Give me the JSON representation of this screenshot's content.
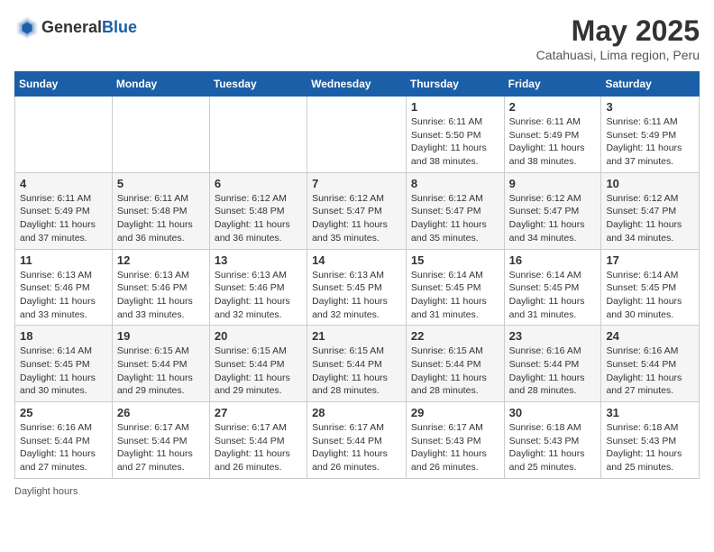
{
  "header": {
    "logo_general": "General",
    "logo_blue": "Blue",
    "month": "May 2025",
    "location": "Catahuasi, Lima region, Peru"
  },
  "days_of_week": [
    "Sunday",
    "Monday",
    "Tuesday",
    "Wednesday",
    "Thursday",
    "Friday",
    "Saturday"
  ],
  "weeks": [
    [
      {
        "day": "",
        "info": ""
      },
      {
        "day": "",
        "info": ""
      },
      {
        "day": "",
        "info": ""
      },
      {
        "day": "",
        "info": ""
      },
      {
        "day": "1",
        "info": "Sunrise: 6:11 AM\nSunset: 5:50 PM\nDaylight: 11 hours and 38 minutes."
      },
      {
        "day": "2",
        "info": "Sunrise: 6:11 AM\nSunset: 5:49 PM\nDaylight: 11 hours and 38 minutes."
      },
      {
        "day": "3",
        "info": "Sunrise: 6:11 AM\nSunset: 5:49 PM\nDaylight: 11 hours and 37 minutes."
      }
    ],
    [
      {
        "day": "4",
        "info": "Sunrise: 6:11 AM\nSunset: 5:49 PM\nDaylight: 11 hours and 37 minutes."
      },
      {
        "day": "5",
        "info": "Sunrise: 6:11 AM\nSunset: 5:48 PM\nDaylight: 11 hours and 36 minutes."
      },
      {
        "day": "6",
        "info": "Sunrise: 6:12 AM\nSunset: 5:48 PM\nDaylight: 11 hours and 36 minutes."
      },
      {
        "day": "7",
        "info": "Sunrise: 6:12 AM\nSunset: 5:47 PM\nDaylight: 11 hours and 35 minutes."
      },
      {
        "day": "8",
        "info": "Sunrise: 6:12 AM\nSunset: 5:47 PM\nDaylight: 11 hours and 35 minutes."
      },
      {
        "day": "9",
        "info": "Sunrise: 6:12 AM\nSunset: 5:47 PM\nDaylight: 11 hours and 34 minutes."
      },
      {
        "day": "10",
        "info": "Sunrise: 6:12 AM\nSunset: 5:47 PM\nDaylight: 11 hours and 34 minutes."
      }
    ],
    [
      {
        "day": "11",
        "info": "Sunrise: 6:13 AM\nSunset: 5:46 PM\nDaylight: 11 hours and 33 minutes."
      },
      {
        "day": "12",
        "info": "Sunrise: 6:13 AM\nSunset: 5:46 PM\nDaylight: 11 hours and 33 minutes."
      },
      {
        "day": "13",
        "info": "Sunrise: 6:13 AM\nSunset: 5:46 PM\nDaylight: 11 hours and 32 minutes."
      },
      {
        "day": "14",
        "info": "Sunrise: 6:13 AM\nSunset: 5:45 PM\nDaylight: 11 hours and 32 minutes."
      },
      {
        "day": "15",
        "info": "Sunrise: 6:14 AM\nSunset: 5:45 PM\nDaylight: 11 hours and 31 minutes."
      },
      {
        "day": "16",
        "info": "Sunrise: 6:14 AM\nSunset: 5:45 PM\nDaylight: 11 hours and 31 minutes."
      },
      {
        "day": "17",
        "info": "Sunrise: 6:14 AM\nSunset: 5:45 PM\nDaylight: 11 hours and 30 minutes."
      }
    ],
    [
      {
        "day": "18",
        "info": "Sunrise: 6:14 AM\nSunset: 5:45 PM\nDaylight: 11 hours and 30 minutes."
      },
      {
        "day": "19",
        "info": "Sunrise: 6:15 AM\nSunset: 5:44 PM\nDaylight: 11 hours and 29 minutes."
      },
      {
        "day": "20",
        "info": "Sunrise: 6:15 AM\nSunset: 5:44 PM\nDaylight: 11 hours and 29 minutes."
      },
      {
        "day": "21",
        "info": "Sunrise: 6:15 AM\nSunset: 5:44 PM\nDaylight: 11 hours and 28 minutes."
      },
      {
        "day": "22",
        "info": "Sunrise: 6:15 AM\nSunset: 5:44 PM\nDaylight: 11 hours and 28 minutes."
      },
      {
        "day": "23",
        "info": "Sunrise: 6:16 AM\nSunset: 5:44 PM\nDaylight: 11 hours and 28 minutes."
      },
      {
        "day": "24",
        "info": "Sunrise: 6:16 AM\nSunset: 5:44 PM\nDaylight: 11 hours and 27 minutes."
      }
    ],
    [
      {
        "day": "25",
        "info": "Sunrise: 6:16 AM\nSunset: 5:44 PM\nDaylight: 11 hours and 27 minutes."
      },
      {
        "day": "26",
        "info": "Sunrise: 6:17 AM\nSunset: 5:44 PM\nDaylight: 11 hours and 27 minutes."
      },
      {
        "day": "27",
        "info": "Sunrise: 6:17 AM\nSunset: 5:44 PM\nDaylight: 11 hours and 26 minutes."
      },
      {
        "day": "28",
        "info": "Sunrise: 6:17 AM\nSunset: 5:44 PM\nDaylight: 11 hours and 26 minutes."
      },
      {
        "day": "29",
        "info": "Sunrise: 6:17 AM\nSunset: 5:43 PM\nDaylight: 11 hours and 26 minutes."
      },
      {
        "day": "30",
        "info": "Sunrise: 6:18 AM\nSunset: 5:43 PM\nDaylight: 11 hours and 25 minutes."
      },
      {
        "day": "31",
        "info": "Sunrise: 6:18 AM\nSunset: 5:43 PM\nDaylight: 11 hours and 25 minutes."
      }
    ]
  ],
  "footer": {
    "note": "Daylight hours"
  }
}
